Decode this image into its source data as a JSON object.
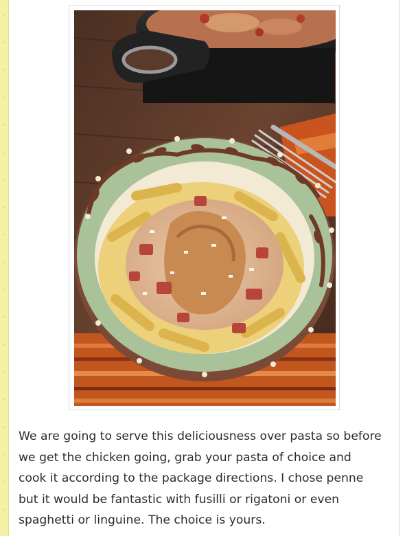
{
  "post": {
    "image": {
      "alt": "",
      "icon": "food-photo"
    },
    "paragraph": "We are going to serve this deliciousness over pasta so before\nwe get the chicken going, grab your pasta of choice and\ncook it according to the package directions. I chose penne\nbut it would be fantastic with fusilli or rigatoni or even\nspaghetti or linguine. The choice is yours."
  },
  "colors": {
    "stripe": "#f4f0a6",
    "text": "#2b2b2b",
    "frame_border": "#d6d6d6"
  }
}
